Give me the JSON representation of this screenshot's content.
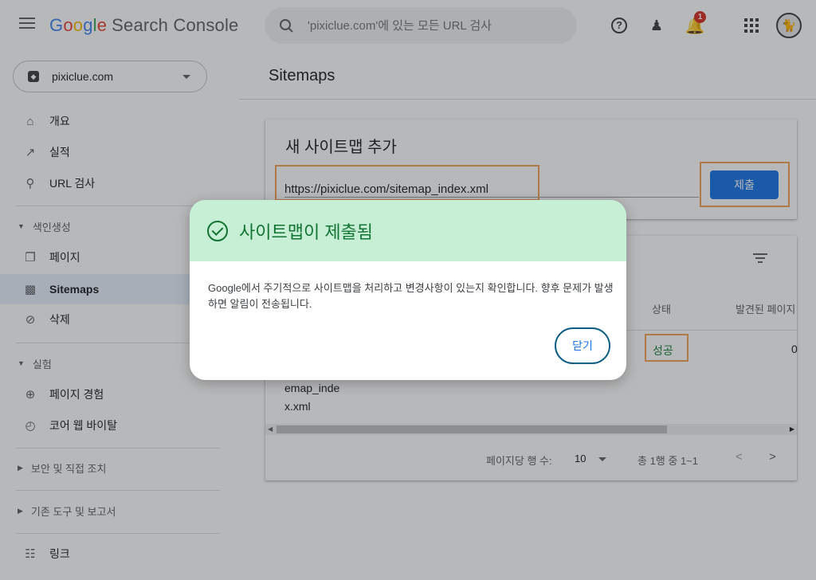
{
  "app": {
    "logo_google": [
      "G",
      "o",
      "o",
      "g",
      "l",
      "e"
    ],
    "logo_product": "Search Console"
  },
  "search": {
    "placeholder": "'pixiclue.com'에 있는 모든 URL 검사"
  },
  "topbar": {
    "notification_count": "1"
  },
  "property": {
    "label": "pixiclue.com"
  },
  "sidebar": {
    "items": [
      {
        "label": "개요",
        "icon": "home-icon"
      },
      {
        "label": "실적",
        "icon": "trending-icon"
      },
      {
        "label": "URL 검사",
        "icon": "search-icon"
      }
    ],
    "section_index": {
      "label": "색인생성"
    },
    "index_items": [
      {
        "label": "페이지",
        "icon": "pages-icon"
      },
      {
        "label": "Sitemaps",
        "icon": "sitemap-icon",
        "active": true
      },
      {
        "label": "삭제",
        "icon": "removals-icon"
      }
    ],
    "section_experience": {
      "label": "실험"
    },
    "experience_items": [
      {
        "label": "페이지 경험",
        "icon": "plus-circle-icon"
      },
      {
        "label": "코어 웹 바이탈",
        "icon": "gauge-icon"
      }
    ],
    "section_security": {
      "label": "보안 및 직접 조치"
    },
    "section_legacy": {
      "label": "기존 도구 및 보고서"
    },
    "links_item": {
      "label": "링크",
      "icon": "links-icon"
    }
  },
  "main": {
    "title": "Sitemaps",
    "add_card": {
      "title": "새 사이트맵 추가",
      "url_value": "https://pixiclue.com/sitemap_index.xml",
      "submit_label": "제출"
    },
    "list_card": {
      "col_status": "상태",
      "col_found": "발견된 페이지",
      "row_status": "성공",
      "row_count": "0",
      "row_url_line1": "emap_inde",
      "row_url_line2": "x.xml",
      "rows_per_page_label": "페이지당 행 수:",
      "rows_per_page_value": "10",
      "range_label": "총 1행 중 1~1",
      "prev": "<",
      "next": ">"
    }
  },
  "dialog": {
    "title": "사이트맵이 제출됨",
    "body": "Google에서 주기적으로 사이트맵을 처리하고 변경사항이 있는지 확인합니다. 향후 문제가 발생하면 알림이 전송됩니다.",
    "close_label": "닫기"
  },
  "colors": {
    "accent": "#1a73e8",
    "success": "#137333",
    "dialog_header": "#c6efd5",
    "highlight": "#f4a259"
  }
}
